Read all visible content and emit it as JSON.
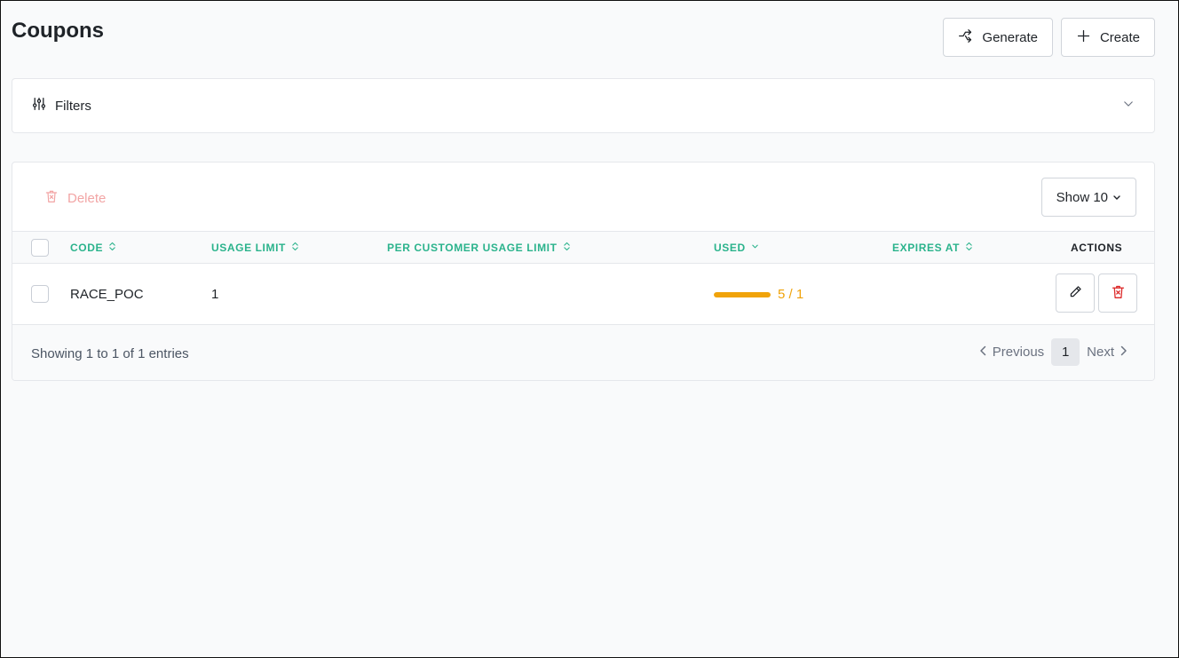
{
  "page": {
    "title": "Coupons"
  },
  "top_actions": {
    "generate_label": "Generate",
    "create_label": "Create"
  },
  "filters": {
    "label": "Filters"
  },
  "toolbar": {
    "delete_label": "Delete",
    "show_label": "Show 10"
  },
  "table": {
    "headers": {
      "code": "CODE",
      "usage_limit": "USAGE LIMIT",
      "per_customer": "PER CUSTOMER USAGE LIMIT",
      "used": "USED",
      "expires_at": "EXPIRES AT",
      "actions": "ACTIONS"
    },
    "rows": [
      {
        "code": "RACE_POC",
        "usage_limit": "1",
        "per_customer": "",
        "used_text": "5 / 1",
        "used_fraction": 1.0,
        "expires_at": ""
      }
    ]
  },
  "footer": {
    "showing": "Showing 1 to 1 of 1 entries",
    "previous": "Previous",
    "page": "1",
    "next": "Next"
  },
  "colors": {
    "accent": "#2bb38c",
    "warning": "#f0a30a",
    "danger": "#dc2626",
    "delete_disabled": "#f2a5a5"
  },
  "icons": {
    "generate": "shuffle-icon",
    "create": "plus-icon",
    "filters": "sliders-icon",
    "filters_toggle": "chevron-down-icon",
    "delete": "trash-icon",
    "edit": "pencil-icon",
    "row_delete": "trash-icon"
  }
}
